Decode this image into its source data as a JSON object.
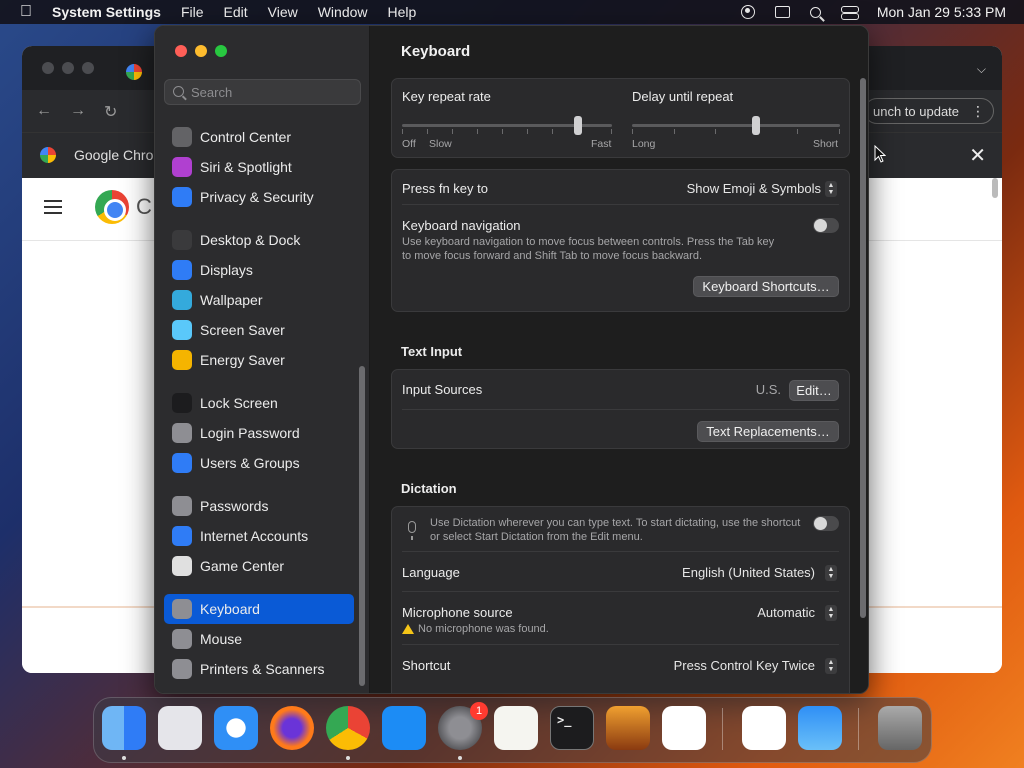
{
  "menubar": {
    "app_name": "System Settings",
    "menus": [
      "File",
      "Edit",
      "View",
      "Window",
      "Help"
    ],
    "datetime": "Mon Jan 29  5:33 PM"
  },
  "chrome": {
    "relaunch_text": "unch to update",
    "tab_label": "Google Chrom",
    "page_partial_text": "C"
  },
  "settings": {
    "search_placeholder": "Search",
    "sidebar": {
      "items": [
        {
          "label": "Control Center",
          "icon": "control-center-icon",
          "color": "#636366"
        },
        {
          "label": "Siri & Spotlight",
          "icon": "siri-icon",
          "color": "#b040d0"
        },
        {
          "label": "Privacy & Security",
          "icon": "hand-icon",
          "color": "#2f7cf6"
        },
        {
          "label": "Desktop & Dock",
          "icon": "dock-icon",
          "color": "#3a3a3c"
        },
        {
          "label": "Displays",
          "icon": "sun-icon",
          "color": "#2f7cf6"
        },
        {
          "label": "Wallpaper",
          "icon": "wallpaper-icon",
          "color": "#34aadc"
        },
        {
          "label": "Screen Saver",
          "icon": "screen-saver-icon",
          "color": "#5ac8fa"
        },
        {
          "label": "Energy Saver",
          "icon": "bulb-icon",
          "color": "#f5b400"
        },
        {
          "label": "Lock Screen",
          "icon": "lock-icon",
          "color": "#1c1c1e"
        },
        {
          "label": "Login Password",
          "icon": "login-lock-icon",
          "color": "#8e8e93"
        },
        {
          "label": "Users & Groups",
          "icon": "users-icon",
          "color": "#2f7cf6"
        },
        {
          "label": "Passwords",
          "icon": "key-icon",
          "color": "#8e8e93"
        },
        {
          "label": "Internet Accounts",
          "icon": "at-icon",
          "color": "#2f7cf6"
        },
        {
          "label": "Game Center",
          "icon": "game-center-icon",
          "color": "#e0e0e0"
        },
        {
          "label": "Keyboard",
          "icon": "keyboard-icon",
          "color": "#8e8e93"
        },
        {
          "label": "Mouse",
          "icon": "mouse-icon",
          "color": "#8e8e93"
        },
        {
          "label": "Printers & Scanners",
          "icon": "printer-icon",
          "color": "#8e8e93"
        }
      ],
      "active": "Keyboard"
    },
    "main": {
      "title": "Keyboard",
      "key_repeat": {
        "label": "Key repeat rate",
        "off": "Off",
        "slow": "Slow",
        "fast": "Fast"
      },
      "delay_repeat": {
        "label": "Delay until repeat",
        "long": "Long",
        "short": "Short"
      },
      "fn_key": {
        "label": "Press fn key to",
        "value": "Show Emoji & Symbols"
      },
      "keyboard_nav": {
        "label": "Keyboard navigation",
        "desc_line1": "Use keyboard navigation to move focus between controls. Press the Tab key",
        "desc_line2": "to move focus forward and Shift Tab to move focus backward."
      },
      "shortcuts_button": "Keyboard Shortcuts…",
      "text_input_header": "Text Input",
      "input_sources": {
        "label": "Input Sources",
        "value": "U.S.",
        "edit": "Edit…"
      },
      "text_replacements_button": "Text Replacements…",
      "dictation_header": "Dictation",
      "dictation_desc_line1": "Use Dictation wherever you can type text. To start dictating, use the shortcut",
      "dictation_desc_line2": "or select Start Dictation from the Edit menu.",
      "language": {
        "label": "Language",
        "value": "English (United States)"
      },
      "microphone": {
        "label": "Microphone source",
        "value": "Automatic",
        "warning": "No microphone was found."
      },
      "shortcut": {
        "label": "Shortcut",
        "value": "Press Control Key Twice"
      }
    }
  },
  "dock": {
    "apps": [
      {
        "name": "Finder",
        "icon": "finder-icon"
      },
      {
        "name": "Launchpad",
        "icon": "launchpad-icon"
      },
      {
        "name": "Safari",
        "icon": "safari-icon"
      },
      {
        "name": "Firefox",
        "icon": "firefox-icon"
      },
      {
        "name": "Chrome",
        "icon": "chrome-icon"
      },
      {
        "name": "App Store",
        "icon": "app-store-icon"
      },
      {
        "name": "System Settings",
        "icon": "system-settings-icon",
        "badge": "1"
      },
      {
        "name": "TextEdit",
        "icon": "textedit-icon"
      },
      {
        "name": "Terminal",
        "icon": "terminal-icon"
      },
      {
        "name": "GarageBand",
        "icon": "guitar-icon"
      },
      {
        "name": "VS Code",
        "icon": "vscode-icon"
      },
      {
        "name": "Visual Studio",
        "icon": "visual-studio-icon"
      },
      {
        "name": "Weather",
        "icon": "weather-icon"
      },
      {
        "name": "Trash",
        "icon": "trash-icon"
      }
    ],
    "terminal_glyph": ">_"
  }
}
